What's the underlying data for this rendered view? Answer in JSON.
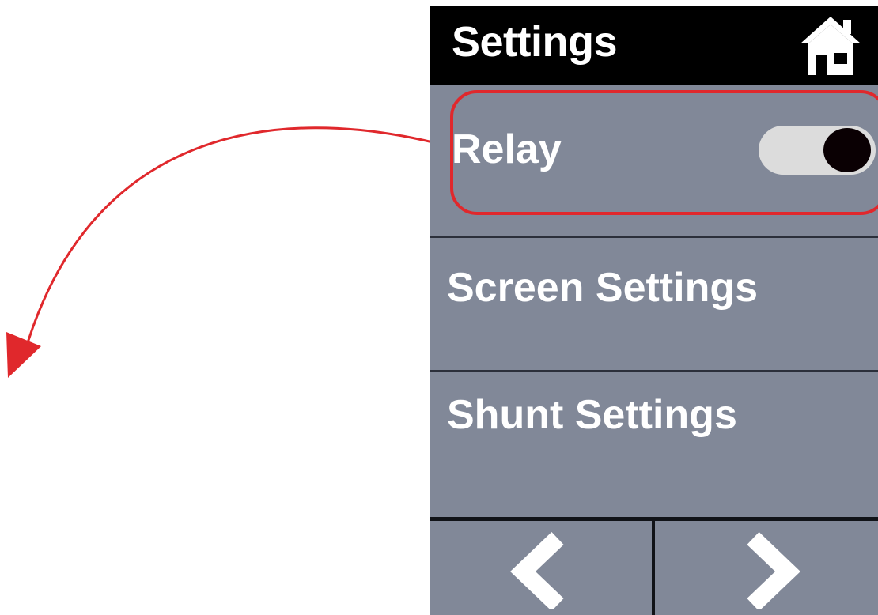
{
  "header": {
    "title": "Settings",
    "home_icon": "home-icon"
  },
  "menu": {
    "items": [
      {
        "label": "Relay",
        "toggle_on": true
      },
      {
        "label": "Screen Settings"
      },
      {
        "label": "Shunt Settings"
      }
    ]
  },
  "nav": {
    "prev_icon": "chevron-left-icon",
    "next_icon": "chevron-right-icon"
  },
  "colors": {
    "header_bg": "#000000",
    "panel_bg": "#818898",
    "text": "#ffffff",
    "highlight": "#e0282c",
    "toggle_track": "#dcdcdc",
    "toggle_knob": "#0a0003"
  }
}
